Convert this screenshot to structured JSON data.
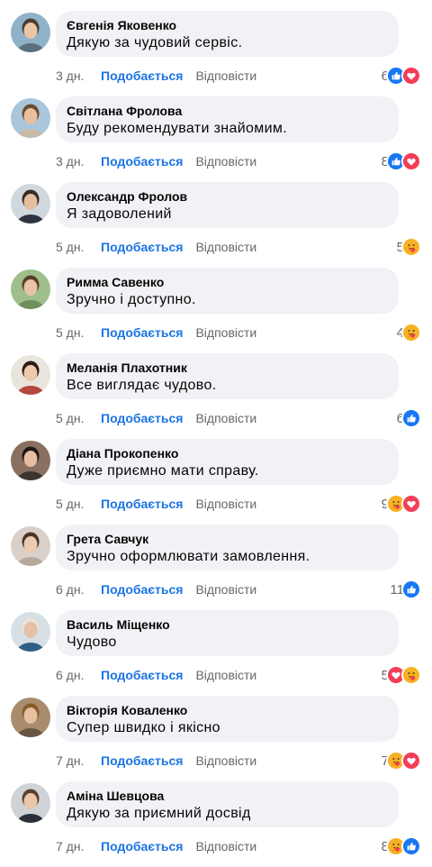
{
  "labels": {
    "like": "Подобається",
    "reply": "Відповісти"
  },
  "colors": {
    "like_text": "#1b74e4",
    "bubble": "#f0f2f5",
    "like_reaction": "#1877f2",
    "love_reaction": "#f33e58",
    "care_reaction": "#f7b125"
  },
  "comments": [
    {
      "author": "Євгенія Яковенко",
      "text": "Дякую за чудовий сервіс.",
      "time": "3 дн.",
      "count": "6",
      "reactions": [
        "like",
        "love"
      ]
    },
    {
      "author": "Світлана Фролова",
      "text": "Буду рекомендувати знайомим.",
      "time": "3 дн.",
      "count": "8",
      "reactions": [
        "like",
        "love"
      ]
    },
    {
      "author": "Олександр Фролов",
      "text": "Я задоволений",
      "time": "5 дн.",
      "count": "5",
      "reactions": [
        "care"
      ]
    },
    {
      "author": "Римма Савенко",
      "text": "Зручно і доступно.",
      "time": "5 дн.",
      "count": "4",
      "reactions": [
        "care"
      ]
    },
    {
      "author": "Меланія Плахотник",
      "text": "Все виглядає чудово.",
      "time": "5 дн.",
      "count": "6",
      "reactions": [
        "like"
      ]
    },
    {
      "author": "Діана Прокопенко",
      "text": "Дуже приємно мати справу.",
      "time": "5 дн.",
      "count": "9",
      "reactions": [
        "care",
        "love"
      ]
    },
    {
      "author": "Грета Савчук",
      "text": "Зручно оформлювати замовлення.",
      "time": "6 дн.",
      "count": "11",
      "reactions": [
        "like"
      ]
    },
    {
      "author": "Василь Міщенко",
      "text": "Чудово",
      "time": "6 дн.",
      "count": "5",
      "reactions": [
        "love",
        "care"
      ]
    },
    {
      "author": "Вікторія Коваленко",
      "text": "Супер швидко і якісно",
      "time": "7 дн.",
      "count": "7",
      "reactions": [
        "care",
        "love"
      ]
    },
    {
      "author": "Аміна Шевцова",
      "text": "Дякую за приємний досвід",
      "time": "7 дн.",
      "count": "8",
      "reactions": [
        "care",
        "like"
      ]
    }
  ]
}
